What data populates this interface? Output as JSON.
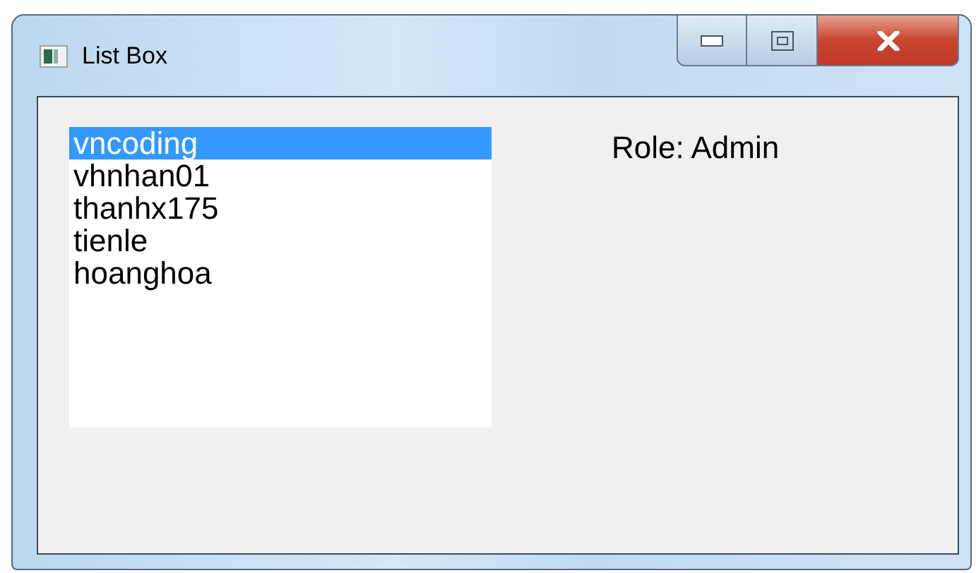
{
  "window": {
    "title": "List Box"
  },
  "list": [
    {
      "label": "vncoding",
      "selected": true
    },
    {
      "label": "vhnhan01",
      "selected": false
    },
    {
      "label": "thanhx175",
      "selected": false
    },
    {
      "label": "tienle",
      "selected": false
    },
    {
      "label": "hoanghoa",
      "selected": false
    }
  ],
  "role_label": "Role: Admin"
}
